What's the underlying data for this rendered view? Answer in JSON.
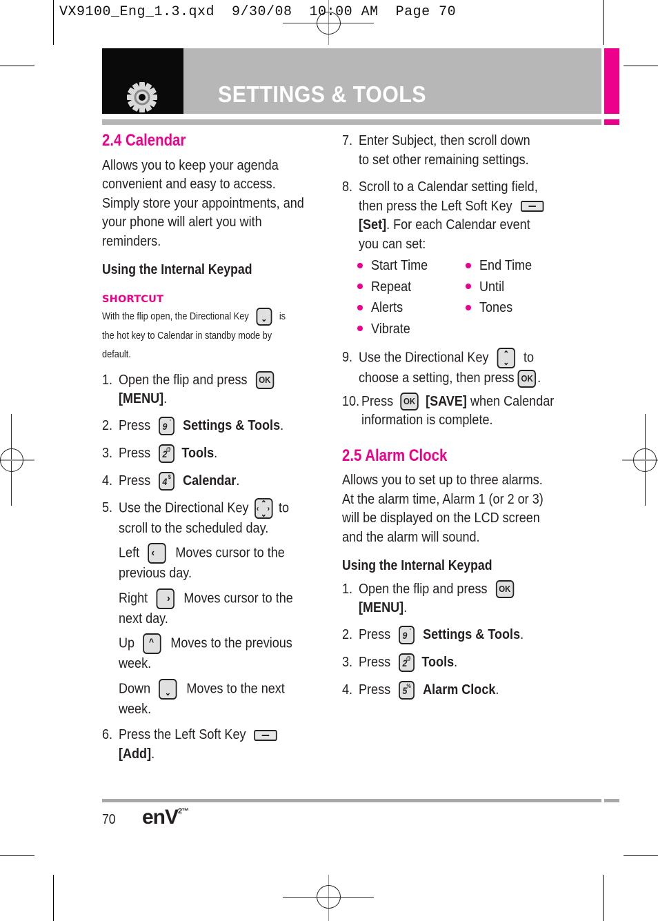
{
  "slug": "VX9100_Eng_1.3.qxd  9/30/08  10:00 AM  Page 70",
  "header": {
    "title": "SETTINGS & TOOLS",
    "icon": "gear-icon",
    "colors": {
      "accent": "#ec008c",
      "banner": "#b8b7b8",
      "icon_bg": "#0a0a0a"
    }
  },
  "calendar": {
    "title": "2.4 Calendar",
    "intro": [
      "Allows you to keep your agenda",
      "convenient and easy to access.",
      "Simply store your appointments, and",
      "your phone will alert you with",
      "reminders."
    ],
    "subhead": "Using the Internal Keypad",
    "shortcut": {
      "label": "SHORTCUT",
      "line1_a": "With the flip open, the Directional Key",
      "line1_b": "is",
      "line2": "the hot key to Calendar in standby mode by",
      "line3": "default."
    },
    "steps": {
      "s1": {
        "num": "1.",
        "text": "Open the flip and press",
        "line2": "[MENU]",
        "key": "OK"
      },
      "s2": {
        "num": "2.",
        "text": "Press",
        "key": "9",
        "key_sup": "'",
        "bold": "Settings & Tools"
      },
      "s3": {
        "num": "3.",
        "text": "Press",
        "key": "2",
        "key_sup": "@",
        "bold": "Tools"
      },
      "s4": {
        "num": "4.",
        "text": "Press",
        "key": "4",
        "key_sup": "$",
        "bold": "Calendar"
      },
      "s5": {
        "num": "5.",
        "text_a": "Use the Directional Key",
        "text_b": "to",
        "line2": "scroll to the scheduled day."
      },
      "dirs": [
        {
          "label": "Left",
          "desc": "Moves cursor to the",
          "desc2": "previous day."
        },
        {
          "label": "Right",
          "desc": "Moves cursor to the",
          "desc2": "next day."
        },
        {
          "label": "Up",
          "desc": "Moves to the previous",
          "desc2": "week."
        },
        {
          "label": "Down",
          "desc": "Moves to the next",
          "desc2": "week."
        }
      ],
      "s6": {
        "num": "6.",
        "text": "Press the Left Soft Key",
        "line2": "[Add]"
      },
      "s7": {
        "num": "7.",
        "text": "Enter Subject, then scroll down",
        "line2": "to set other remaining settings."
      },
      "s8": {
        "num": "8.",
        "text": "Scroll to a Calendar setting field,",
        "line2": "then press the Left Soft Key",
        "line3_bold": "[Set]",
        "line3": ". For each Calendar event",
        "line4": "you can set:"
      },
      "options": [
        "Start Time",
        "End Time",
        "Repeat",
        "Until",
        "Alerts",
        "Tones",
        "Vibrate"
      ],
      "s9": {
        "num": "9.",
        "text_a": "Use the Directional Key",
        "text_b": "to",
        "line2": "choose a setting, then press"
      },
      "s10": {
        "num": "10.",
        "text": "Press",
        "bold": "[SAVE]",
        "text_b": "when Calendar",
        "line2": "information is complete."
      }
    }
  },
  "alarm": {
    "title": "2.5 Alarm Clock",
    "intro": [
      "Allows you to set up to three alarms.",
      "At the alarm time, Alarm 1 (or 2 or 3)",
      "will be displayed on the LCD screen",
      "and the alarm will sound."
    ],
    "subhead": "Using the Internal Keypad",
    "steps": {
      "s1": {
        "num": "1.",
        "text": "Open the flip and press",
        "line2": "[MENU]",
        "key": "OK"
      },
      "s2": {
        "num": "2.",
        "text": "Press",
        "key": "9",
        "key_sup": "'",
        "bold": "Settings & Tools"
      },
      "s3": {
        "num": "3.",
        "text": "Press",
        "key": "2",
        "key_sup": "@",
        "bold": "Tools"
      },
      "s4": {
        "num": "4.",
        "text": "Press",
        "key": "5",
        "key_sup": "%",
        "bold": "Alarm Clock"
      }
    }
  },
  "footer": {
    "page_number": "70",
    "brand": "enV",
    "brand_sup": "2™"
  }
}
